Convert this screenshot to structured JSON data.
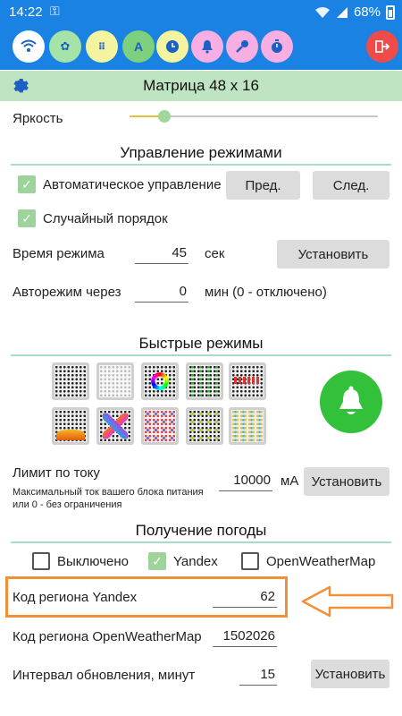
{
  "status_bar": {
    "time": "14:22",
    "battery": "68%"
  },
  "toolbar": {
    "buttons": [
      {
        "icon": "wifi-icon",
        "color": "#ffffff"
      },
      {
        "icon": "settings-icon",
        "color": "#a6e3a9"
      },
      {
        "icon": "matrix-icon",
        "color": "#f3f3a0"
      },
      {
        "icon": "text-icon",
        "color": "#7dd07d",
        "glyph": "A"
      },
      {
        "icon": "clock-icon",
        "color": "#f3f3a0"
      },
      {
        "icon": "alarm-icon",
        "color": "#f7aee3"
      },
      {
        "icon": "key-icon",
        "color": "#f7aee3"
      },
      {
        "icon": "timer-icon",
        "color": "#f7aee3"
      },
      {
        "icon": "exit-icon",
        "color": "#ef4b4b"
      }
    ]
  },
  "header": {
    "title": "Матрица 48 х 16"
  },
  "brightness": {
    "label": "Яркость",
    "value_fraction": 0.14
  },
  "modes": {
    "title": "Управление режимами",
    "auto_control": {
      "label": "Автоматическое управление",
      "checked": true
    },
    "prev_button": "Пред.",
    "next_button": "След.",
    "random_order": {
      "label": "Случайный порядок",
      "checked": true
    },
    "mode_time": {
      "label": "Время режима",
      "value": "45",
      "unit": "сек",
      "button": "Установить"
    },
    "auto_mode": {
      "label": "Авторежим через",
      "value": "0",
      "unit": "мин (0 - отключено)"
    }
  },
  "quick_modes": {
    "title": "Быстрые режимы"
  },
  "current_limit": {
    "label": "Лимит по току",
    "hint": "Максимальный ток вашего блока питания или 0 - без ограничения",
    "value": "10000",
    "unit": "мА",
    "button": "Установить"
  },
  "weather": {
    "title": "Получение погоды",
    "options": [
      {
        "label": "Выключено",
        "checked": false
      },
      {
        "label": "Yandex",
        "checked": true
      },
      {
        "label": "OpenWeatherMap",
        "checked": false
      }
    ],
    "yandex_region": {
      "label": "Код региона Yandex",
      "value": "62"
    },
    "owm_region": {
      "label": "Код региона OpenWeatherMap",
      "value": "1502026"
    },
    "interval": {
      "label": "Интервал обновления, минут",
      "value": "15",
      "button": "Установить"
    }
  }
}
